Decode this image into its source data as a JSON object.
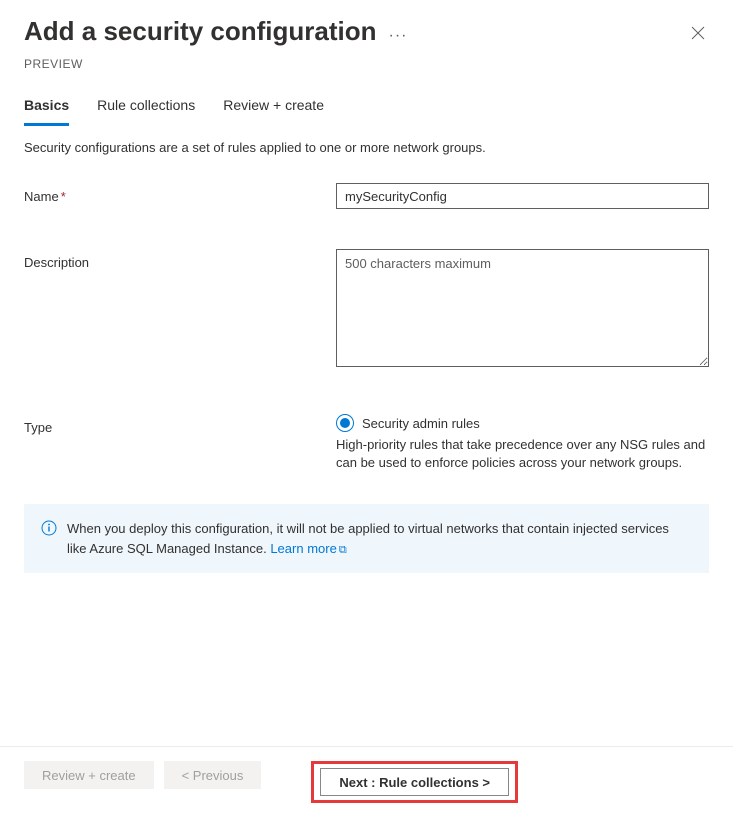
{
  "header": {
    "title": "Add a security configuration",
    "preview_label": "PREVIEW"
  },
  "tabs": [
    {
      "label": "Basics",
      "active": true
    },
    {
      "label": "Rule collections",
      "active": false
    },
    {
      "label": "Review + create",
      "active": false
    }
  ],
  "description": "Security configurations are a set of rules applied to one or more network groups.",
  "form": {
    "name_label": "Name",
    "name_value": "mySecurityConfig",
    "description_label": "Description",
    "description_placeholder": "500 characters maximum",
    "type_label": "Type",
    "type_option": {
      "label": "Security admin rules",
      "description": "High-priority rules that take precedence over any NSG rules and can be used to enforce policies across your network groups."
    }
  },
  "info_box": {
    "text": "When you deploy this configuration, it will not be applied to virtual networks that contain injected services like Azure SQL Managed Instance.",
    "link_text": "Learn more"
  },
  "footer": {
    "review_create": "Review + create",
    "previous": "< Previous",
    "next": "Next : Rule collections >"
  }
}
